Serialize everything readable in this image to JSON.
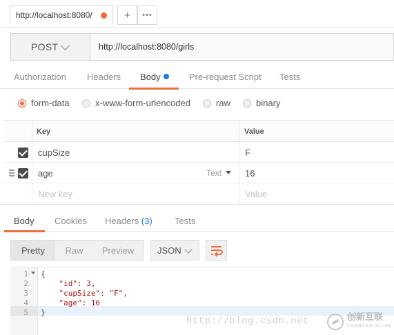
{
  "tab": {
    "title": "http://localhost:8080/",
    "add_icon": "plus-icon",
    "more_icon": "ellipsis-icon",
    "unsaved_color": "#f26b3a"
  },
  "request": {
    "method": "POST",
    "url": "http://localhost:8080/girls"
  },
  "request_tabs": [
    {
      "label": "Authorization"
    },
    {
      "label": "Headers"
    },
    {
      "label": "Body",
      "active": true
    },
    {
      "label": "Pre-request Script"
    },
    {
      "label": "Tests"
    }
  ],
  "body_types": [
    {
      "label": "form-data",
      "selected": true
    },
    {
      "label": "x-www-form-urlencoded"
    },
    {
      "label": "raw"
    },
    {
      "label": "binary"
    }
  ],
  "form": {
    "columns": {
      "key": "Key",
      "value": "Value"
    },
    "rows": [
      {
        "key": "cupSize",
        "value": "F",
        "checked": true
      },
      {
        "key": "age",
        "value": "16",
        "checked": true,
        "type_label": "Text"
      }
    ],
    "placeholder": {
      "key": "New key",
      "value": "Value"
    }
  },
  "response_tabs": [
    {
      "label": "Body",
      "active": true
    },
    {
      "label": "Cookies"
    },
    {
      "label": "Headers",
      "count": "(3)"
    },
    {
      "label": "Tests"
    }
  ],
  "view_modes": [
    {
      "label": "Pretty",
      "active": true
    },
    {
      "label": "Raw"
    },
    {
      "label": "Preview"
    }
  ],
  "format": "JSON",
  "wrap_icon": "wrap-lines-icon",
  "code_lines": [
    {
      "n": "1",
      "text": "{"
    },
    {
      "n": "2",
      "text": "    \"id\": 3,"
    },
    {
      "n": "3",
      "text": "    \"cupSize\": \"F\","
    },
    {
      "n": "4",
      "text": "    \"age\": 16"
    },
    {
      "n": "5",
      "text": "}"
    }
  ],
  "watermark": "http://blog.csdn.net",
  "logo": {
    "name": "创新互联",
    "subtext": "CHUANG XIN HU LIAN"
  },
  "colors": {
    "accent": "#f26b3a",
    "link": "#1f7ae0"
  }
}
